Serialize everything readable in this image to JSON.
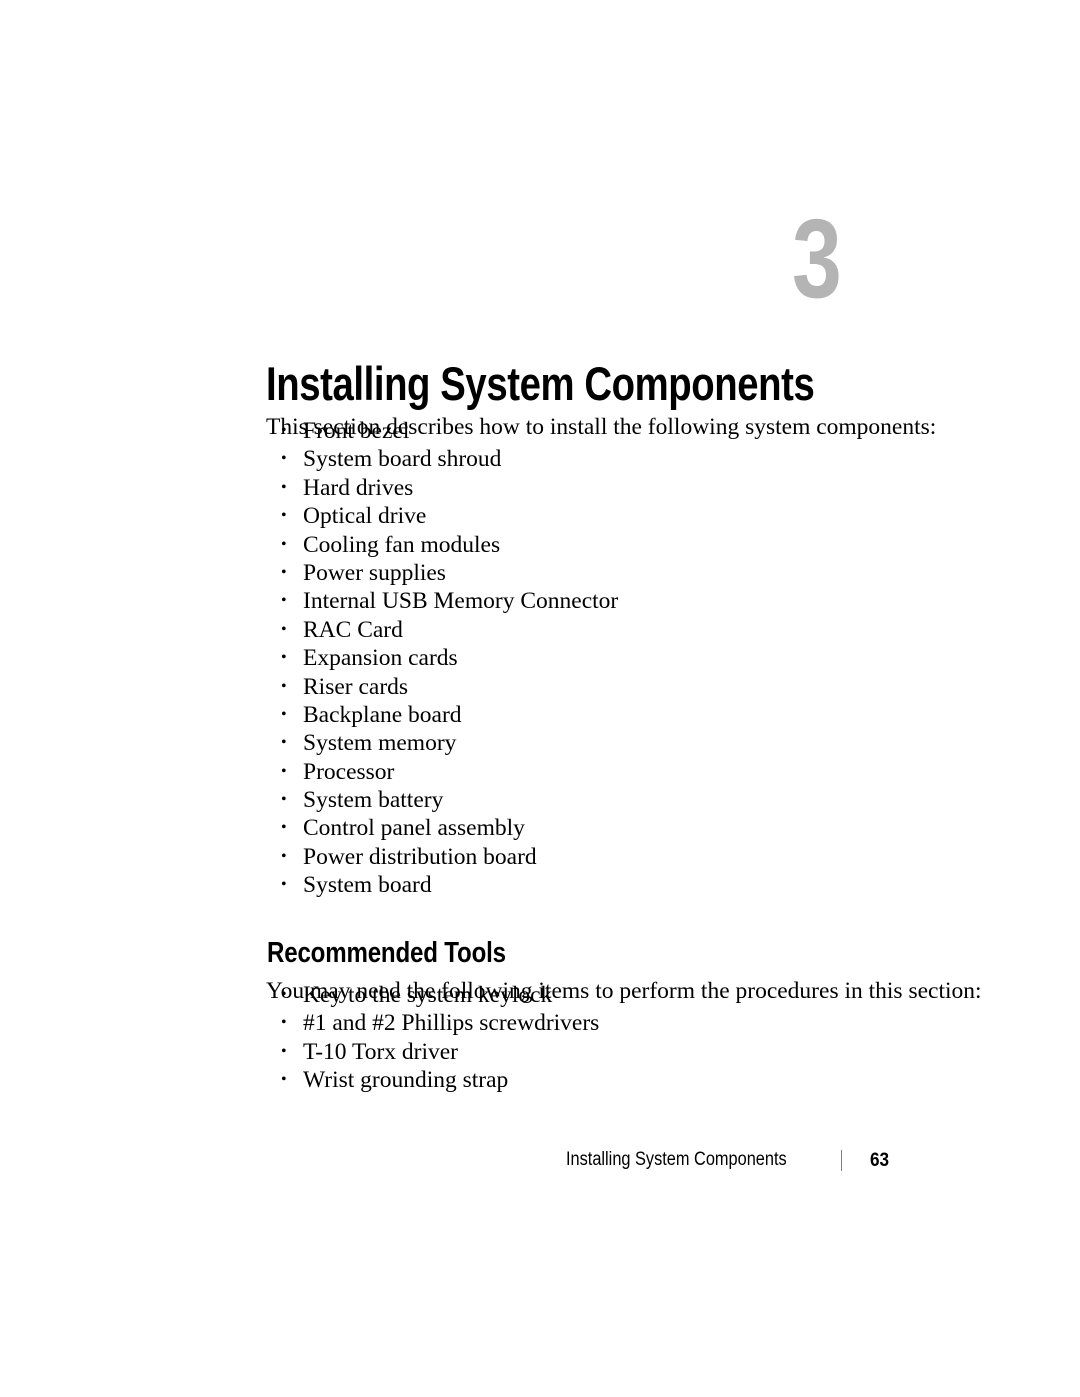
{
  "document": {
    "background_color": "#ffffff",
    "text_color": "#000000"
  },
  "chapter": {
    "number": "3",
    "number_color": "#b4b4b4",
    "title": "Installing System Components",
    "intro": "This section describes how to install the following system components:",
    "bullet_glyph": "•",
    "components": [
      "Front bezel",
      "System board shroud",
      "Hard drives",
      "Optical drive",
      "Cooling fan modules",
      "Power supplies",
      "Internal USB Memory Connector",
      "RAC Card",
      "Expansion cards",
      "Riser cards",
      "Backplane board",
      "System memory",
      "Processor",
      "System battery",
      "Control panel assembly",
      "Power distribution board",
      "System board"
    ]
  },
  "section": {
    "heading": "Recommended Tools",
    "intro": "You may need the following items to perform the procedures in this section:",
    "tools": [
      "Key to the system keylock",
      "#1 and #2 Phillips screwdrivers",
      "T-10 Torx driver",
      "Wrist grounding strap"
    ]
  },
  "footer": {
    "title": "Installing System Components",
    "separator": "|",
    "page_number": "63",
    "separator_color": "#808080"
  }
}
